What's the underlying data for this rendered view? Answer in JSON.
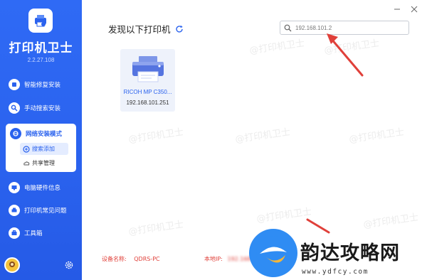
{
  "app": {
    "name": "打印机卫士",
    "version": "2.2.27.108"
  },
  "sidebar": {
    "items": [
      {
        "label": "智能修复安装"
      },
      {
        "label": "手动搜索安装"
      },
      {
        "label": "网络安装模式"
      },
      {
        "label": "电脑硬件信息"
      },
      {
        "label": "打印机常见问题"
      },
      {
        "label": "工具箱"
      }
    ],
    "sub_items": [
      {
        "label": "搜索添加",
        "active": true
      },
      {
        "label": "共享管理",
        "active": false
      }
    ]
  },
  "main": {
    "title": "发现以下打印机",
    "search": {
      "value": "192.168.101.2"
    },
    "printers": [
      {
        "name": "RICOH MP C350...",
        "ip": "192.168.101.251"
      }
    ]
  },
  "footer": {
    "device_label": "设备名称:",
    "device_value": "QDRS-PC",
    "ip_label": "本地IP:",
    "ip_value": "192.168"
  },
  "watermark": "@打印机卫士",
  "brand": {
    "name": "韵达攻略网",
    "url": "www.ydfcy.com"
  },
  "colors": {
    "sidebar": "#2a62ee",
    "accent": "#2a62ee",
    "annotation": "#e0403a"
  }
}
